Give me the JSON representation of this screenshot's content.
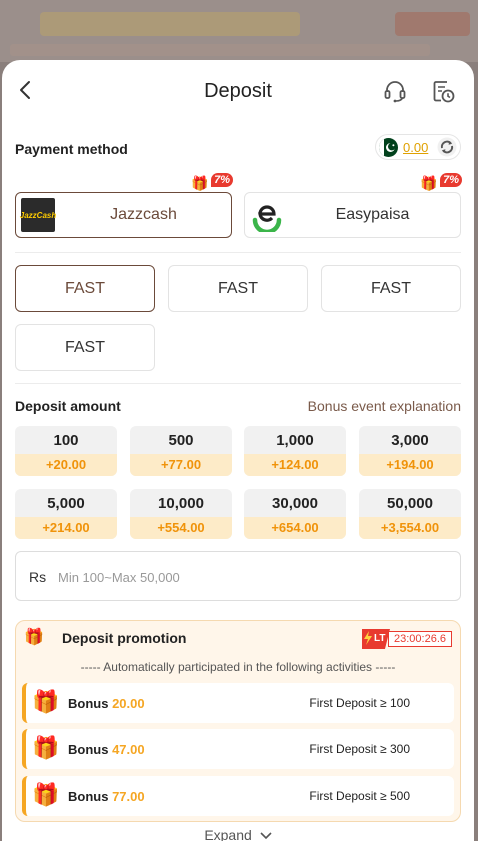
{
  "header": {
    "title": "Deposit"
  },
  "payment": {
    "label": "Payment method",
    "balance": "0.00",
    "methods": [
      {
        "name": "Jazzcash",
        "logo_text": "JazzCash",
        "promo": "7%",
        "selected": true
      },
      {
        "name": "Easypaisa",
        "promo": "7%",
        "selected": false
      }
    ],
    "channels": [
      {
        "label": "FAST",
        "selected": true
      },
      {
        "label": "FAST",
        "selected": false
      },
      {
        "label": "FAST",
        "selected": false
      },
      {
        "label": "FAST",
        "selected": false
      }
    ]
  },
  "deposit": {
    "label": "Deposit amount",
    "bonus_link": "Bonus event explanation",
    "amounts": [
      {
        "value": "100",
        "bonus": "+20.00"
      },
      {
        "value": "500",
        "bonus": "+77.00"
      },
      {
        "value": "1,000",
        "bonus": "+124.00"
      },
      {
        "value": "3,000",
        "bonus": "+194.00"
      },
      {
        "value": "5,000",
        "bonus": "+214.00"
      },
      {
        "value": "10,000",
        "bonus": "+554.00"
      },
      {
        "value": "30,000",
        "bonus": "+654.00"
      },
      {
        "value": "50,000",
        "bonus": "+3,554.00"
      }
    ],
    "currency": "Rs",
    "placeholder": "Min 100~Max 50,000"
  },
  "promotion": {
    "title": "Deposit promotion",
    "timer_badge": "LT",
    "timer": "23:00:26.6",
    "subtitle": "----- Automatically participated in the following activities -----",
    "bonus_label": "Bonus",
    "rows": [
      {
        "amount": "20.00",
        "condition": "First Deposit ≥ 100"
      },
      {
        "amount": "47.00",
        "condition": "First Deposit ≥ 300"
      },
      {
        "amount": "77.00",
        "condition": "First Deposit ≥ 500"
      }
    ]
  },
  "expand_label": "Expand",
  "colors": {
    "accent_brown": "#6b4a3a",
    "bonus_orange": "#f0930a",
    "promo_red": "#e83a2f"
  }
}
